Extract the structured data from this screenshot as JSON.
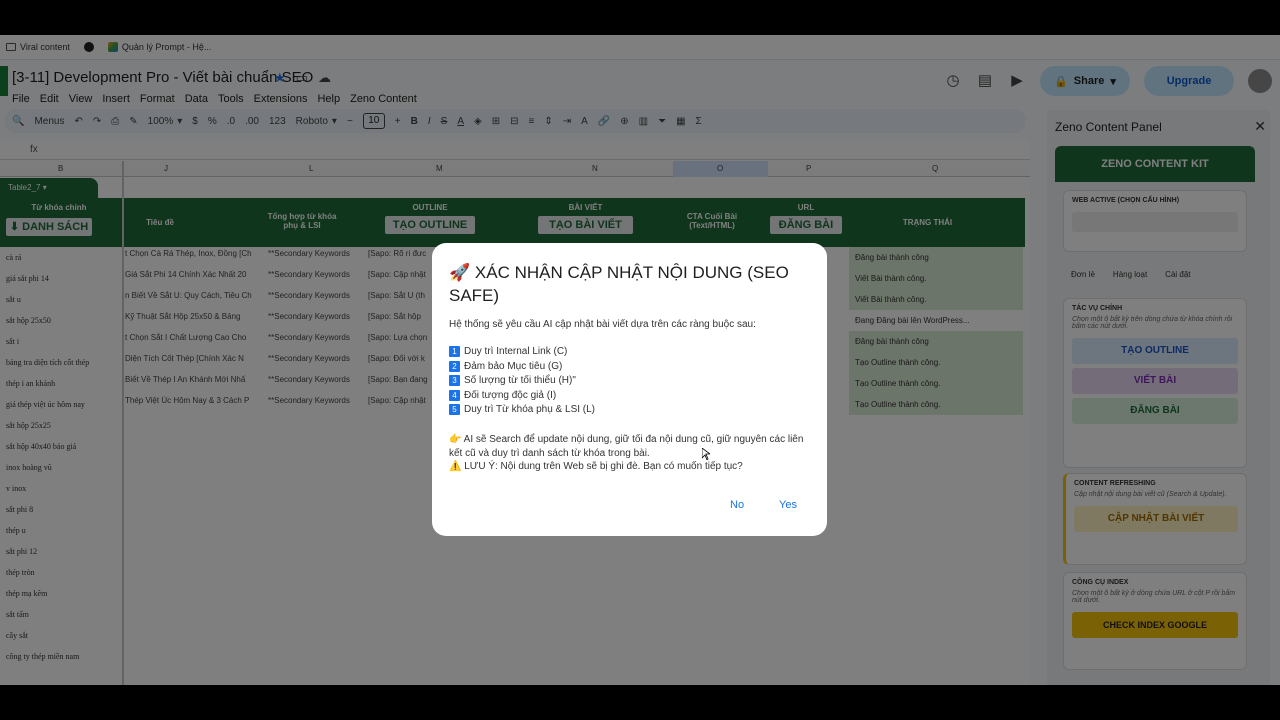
{
  "bookmarks": [
    {
      "label": "Viral content",
      "icon": "folder-icon"
    },
    {
      "label": "",
      "icon": "github-icon"
    },
    {
      "label": "Quản lý Prompt - Hệ...",
      "icon": "sheet-icon"
    }
  ],
  "doc": {
    "title": "[3-11] Development Pro - Viết bài chuẩn SEO",
    "menus": [
      "File",
      "Edit",
      "View",
      "Insert",
      "Format",
      "Data",
      "Tools",
      "Extensions",
      "Help",
      "Zeno Content"
    ]
  },
  "header": {
    "share": "Share",
    "upgrade": "Upgrade"
  },
  "toolbar": {
    "menus": "Menus",
    "zoom": "100%",
    "currency": "$",
    "percent": "%",
    "dec_less": ".0",
    "dec_more": ".00",
    "numfmt": "123",
    "font": "Roboto",
    "font_size": "10"
  },
  "columns": [
    {
      "letter": "B"
    },
    {
      "letter": "J"
    },
    {
      "letter": "L"
    },
    {
      "letter": "M"
    },
    {
      "letter": "N"
    },
    {
      "letter": "O"
    },
    {
      "letter": "P"
    },
    {
      "letter": "Q"
    }
  ],
  "table": {
    "tag": "Table2_7",
    "headers": {
      "keyword": "Từ khóa chính",
      "title": "Tiêu đề",
      "lsi": "Tổng hợp từ khóa phụ & LSI",
      "outline": "OUTLINE",
      "article": "BÀI VIẾT",
      "cta": "CTA Cuối Bài (Text/HTML)",
      "url": "URL",
      "status": "TRẠNG THÁI"
    },
    "buttons": {
      "list": "DANH SÁCH",
      "outline": "TẠO OUTLINE",
      "article": "TẠO BÀI VIẾT",
      "publish": "ĐĂNG BÀI"
    },
    "rows": [
      {
        "kw": "cà rá",
        "title": "t Chọn Cà Rá Thép, Inox, Đồng [Ch",
        "lsi": "**Secondary Keywords",
        "outline": "[Sapo: Rõ ri đưc",
        "status": "Đăng bài thành công"
      },
      {
        "kw": "giá sắt phi 14",
        "title": "Giá Sắt Phi 14 Chính Xác Nhất 20",
        "lsi": "**Secondary Keywords",
        "outline": "[Sapo: Cập nhật",
        "status": "Viết Bài thành công."
      },
      {
        "kw": "sắt u",
        "title": "n Biết Về Sắt U: Quy Cách, Tiêu Ch",
        "lsi": "**Secondary Keywords",
        "outline": "[Sapo: Sắt U (th",
        "status": "Viết Bài thành công."
      },
      {
        "kw": "sắt hộp 25x50",
        "title": "Kỹ Thuật Sắt Hộp 25x50 & Bảng",
        "lsi": "**Secondary Keywords",
        "outline": "[Sapo: Sắt hộp",
        "status": "Đang Đăng bài lên WordPress..."
      },
      {
        "kw": "sắt i",
        "title": "t Chọn Sắt I Chất Lượng Cao Cho",
        "lsi": "**Secondary Keywords",
        "outline": "[Sapo: Lựa chọn",
        "status": "Đăng bài thành công"
      },
      {
        "kw": "bảng tra diện tích cốt thép",
        "title": "Diện Tích Cốt Thép [Chính Xác N",
        "lsi": "**Secondary Keywords",
        "outline": "[Sapo: Đối với k",
        "status": "Tạo Outline thành công."
      },
      {
        "kw": "thép i an khánh",
        "title": "Biết Về Thép I An Khánh Mới Nhấ",
        "lsi": "**Secondary Keywords",
        "outline": "[Sapo: Bạn đang",
        "status": "Tạo Outline thành công."
      },
      {
        "kw": "giá thép việt úc hôm nay",
        "title": "Thép Việt Úc Hôm Nay & 3 Cách P",
        "lsi": "**Secondary Keywords",
        "outline": "[Sapo: Cập nhật",
        "status": "Tạo Outline thành công."
      },
      {
        "kw": "sắt hộp 25x25",
        "title": "",
        "lsi": "",
        "outline": "",
        "status": ""
      },
      {
        "kw": "sắt hộp 40x40 báo giá",
        "title": "",
        "lsi": "",
        "outline": "",
        "status": ""
      },
      {
        "kw": "inox hoàng vũ",
        "title": "",
        "lsi": "",
        "outline": "",
        "status": ""
      },
      {
        "kw": "v inox",
        "title": "",
        "lsi": "",
        "outline": "",
        "status": ""
      },
      {
        "kw": "sắt phi 8",
        "title": "",
        "lsi": "",
        "outline": "",
        "status": ""
      },
      {
        "kw": "thép u",
        "title": "",
        "lsi": "",
        "outline": "",
        "status": ""
      },
      {
        "kw": "sắt phi 12",
        "title": "",
        "lsi": "",
        "outline": "",
        "status": ""
      },
      {
        "kw": "thép tròn",
        "title": "",
        "lsi": "",
        "outline": "",
        "status": ""
      },
      {
        "kw": "thép mạ kẽm",
        "title": "",
        "lsi": "",
        "outline": "",
        "status": ""
      },
      {
        "kw": "sắt tấm",
        "title": "",
        "lsi": "",
        "outline": "",
        "status": ""
      },
      {
        "kw": "cây sắt",
        "title": "",
        "lsi": "",
        "outline": "",
        "status": ""
      },
      {
        "kw": "công ty thép miền nam",
        "title": "",
        "lsi": "",
        "outline": "",
        "status": ""
      }
    ]
  },
  "panel": {
    "title": "Zeno Content Panel",
    "kit": "ZENO CONTENT KIT",
    "web_active": "WEB ACTIVE (CHỌN CẤU HÌNH)",
    "tabs": [
      "Đơn lẻ",
      "Hàng loạt",
      "Cài đặt"
    ],
    "main_tasks": {
      "heading": "TÁC VỤ CHÍNH",
      "desc": "Chọn một ô bất kỳ trên dòng chứa từ khóa chính rồi bấm các nút dưới.",
      "outline": "TẠO OUTLINE",
      "write": "VIẾT BÀI",
      "publish": "ĐĂNG BÀI"
    },
    "refresh": {
      "heading": "CONTENT REFRESHING",
      "desc": "Cập nhật nội dung bài viết cũ (Search & Update).",
      "button": "CẬP NHẬT BÀI VIẾT"
    },
    "index": {
      "heading": "CÔNG CỤ INDEX",
      "desc": "Chọn một ô bất kỳ ở dòng chứa URL ở cột P rồi bấm nút dưới.",
      "button": "CHECK INDEX GOOGLE"
    }
  },
  "dialog": {
    "title": "🚀 XÁC NHẬN CẬP NHẬT NỘI DUNG (SEO SAFE)",
    "intro": "Hệ thống sẽ yêu cầu AI cập nhật bài viết dựa trên các ràng buộc sau:",
    "items": [
      {
        "n": "1",
        "text": "Duy trì Internal Link (C)"
      },
      {
        "n": "2",
        "text": "Đảm bảo Mục tiêu (G)"
      },
      {
        "n": "3",
        "text": "Số lượng từ tối thiểu (H)\""
      },
      {
        "n": "4",
        "text": "Đối tượng độc giả (I)"
      },
      {
        "n": "5",
        "text": "Duy trì Từ khóa phụ & LSI (L)"
      }
    ],
    "note": "👉 AI sẽ Search để update nội dung, giữ tối đa nội dung cũ, giữ nguyên các liên kết cũ và duy trì danh sách từ khóa trong bài.",
    "warning": "⚠️ LƯU Ý: Nội dung trên Web sẽ bị ghi đè. Bạn có muốn tiếp tục?",
    "no": "No",
    "yes": "Yes"
  },
  "colors": {
    "accent_green": "#1e6b3a",
    "status_green": "#d9ead3",
    "link_blue": "#1a73e8",
    "yellow_btn": "#f4c20d"
  }
}
